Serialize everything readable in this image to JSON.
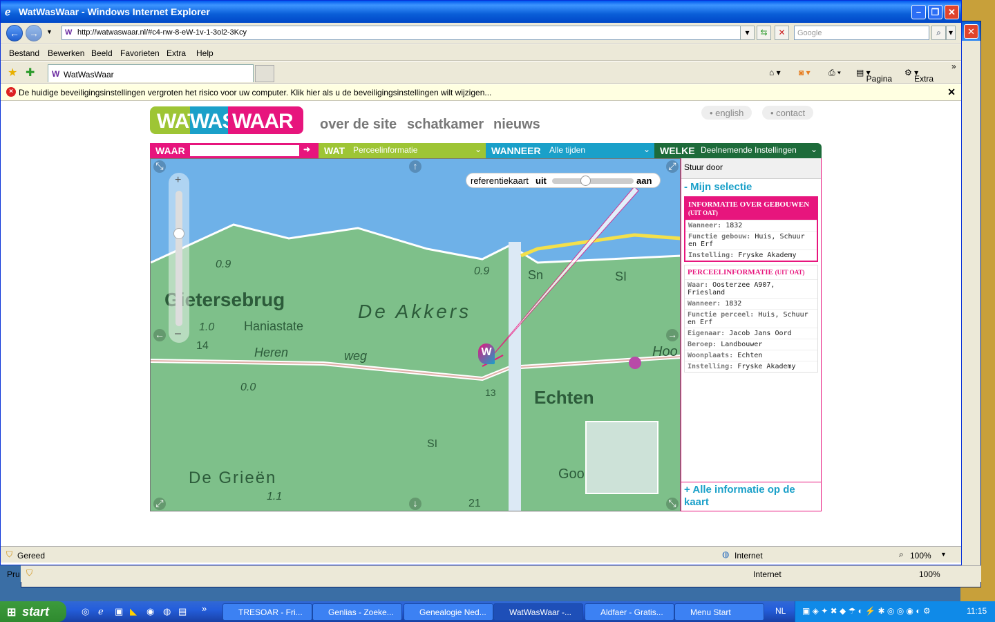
{
  "window": {
    "title": "WatWasWaar - Windows Internet Explorer"
  },
  "address": {
    "url": "http://watwaswaar.nl/#c4-nw-8-eW-1v-1-3ol2-3Kcy",
    "search_placeholder": "Google"
  },
  "menu": {
    "items": [
      "Bestand",
      "Bewerken",
      "Beeld",
      "Favorieten",
      "Extra",
      "Help"
    ]
  },
  "tab": {
    "label": "WatWasWaar"
  },
  "toolbar": {
    "page": "Pagina",
    "extra": "Extra"
  },
  "security": {
    "message": "De huidige beveiligingsinstellingen vergroten het risico voor uw computer. Klik hier als u de beveiligingsinstellingen wilt wijzigen..."
  },
  "site": {
    "logo": {
      "wat": "WAT",
      "was": "WAS",
      "waar": "WAAR"
    },
    "nav": [
      "over de site",
      "schatkamer",
      "nieuws"
    ],
    "toplinks": [
      "english",
      "contact"
    ],
    "selectors": {
      "waar": {
        "label": "WAAR",
        "value": ""
      },
      "wat": {
        "label": "WAT",
        "value": "Perceelinformatie"
      },
      "wanneer": {
        "label": "WANNEER",
        "value": "Alle tijden"
      },
      "welke": {
        "label": "WELKE",
        "value": "Deelnemende Instellingen"
      }
    },
    "map": {
      "reference": {
        "label": "referentiekaart",
        "off": "uit",
        "on": "aan",
        "level": 0.4
      },
      "zoom_level": 0.7,
      "labels": [
        "Gietersebrug",
        "De Akkers",
        "Haniastate",
        "Heren",
        "weg",
        "Echten",
        "De Grieën",
        "Goo",
        "Hoo",
        "SI",
        "Sn",
        "0.9",
        "0.9",
        "1.0",
        "0.0",
        "13",
        "1.1",
        "21",
        "SI",
        "14"
      ],
      "marker": "W"
    },
    "panel": {
      "stuur": "Stuur door",
      "mijn": "- Mijn selectie",
      "card1": {
        "title": "INFORMATIE OVER GEBOUWEN",
        "source": "(UIT OAT)",
        "rows": [
          [
            "Wanneer:",
            "1832"
          ],
          [
            "Functie gebouw:",
            "Huis, Schuur en Erf"
          ],
          [
            "Instelling:",
            "Fryske Akademy"
          ]
        ]
      },
      "card2": {
        "title": "PERCEELINFORMATIE",
        "source": "(UIT OAT)",
        "rows": [
          [
            "Waar:",
            "Oosterzee A907, Friesland"
          ],
          [
            "Wanneer:",
            "1832"
          ],
          [
            "Functie perceel:",
            "Huis, Schuur en Erf"
          ],
          [
            "Eigenaar:",
            "Jacob Jans Oord"
          ],
          [
            "Beroep:",
            "Landbouwer"
          ],
          [
            "Woonplaats:",
            "Echten"
          ],
          [
            "Instelling:",
            "Fryske Akademy"
          ]
        ]
      },
      "alle": "+ Alle informatie op de kaart"
    }
  },
  "status": {
    "text": "Gereed",
    "zone": "Internet",
    "zoom": "100%"
  },
  "back_status": {
    "left": "Pru",
    "zone": "Internet",
    "zoom": "100%"
  },
  "taskbar": {
    "start": "start",
    "tasks": [
      "TRESOAR - Fri...",
      "Genlias - Zoeke...",
      "Genealogie Ned...",
      "WatWasWaar -...",
      "Aldfaer - Gratis...",
      "Menu Start"
    ],
    "lang": "NL",
    "clock": "11:15"
  }
}
